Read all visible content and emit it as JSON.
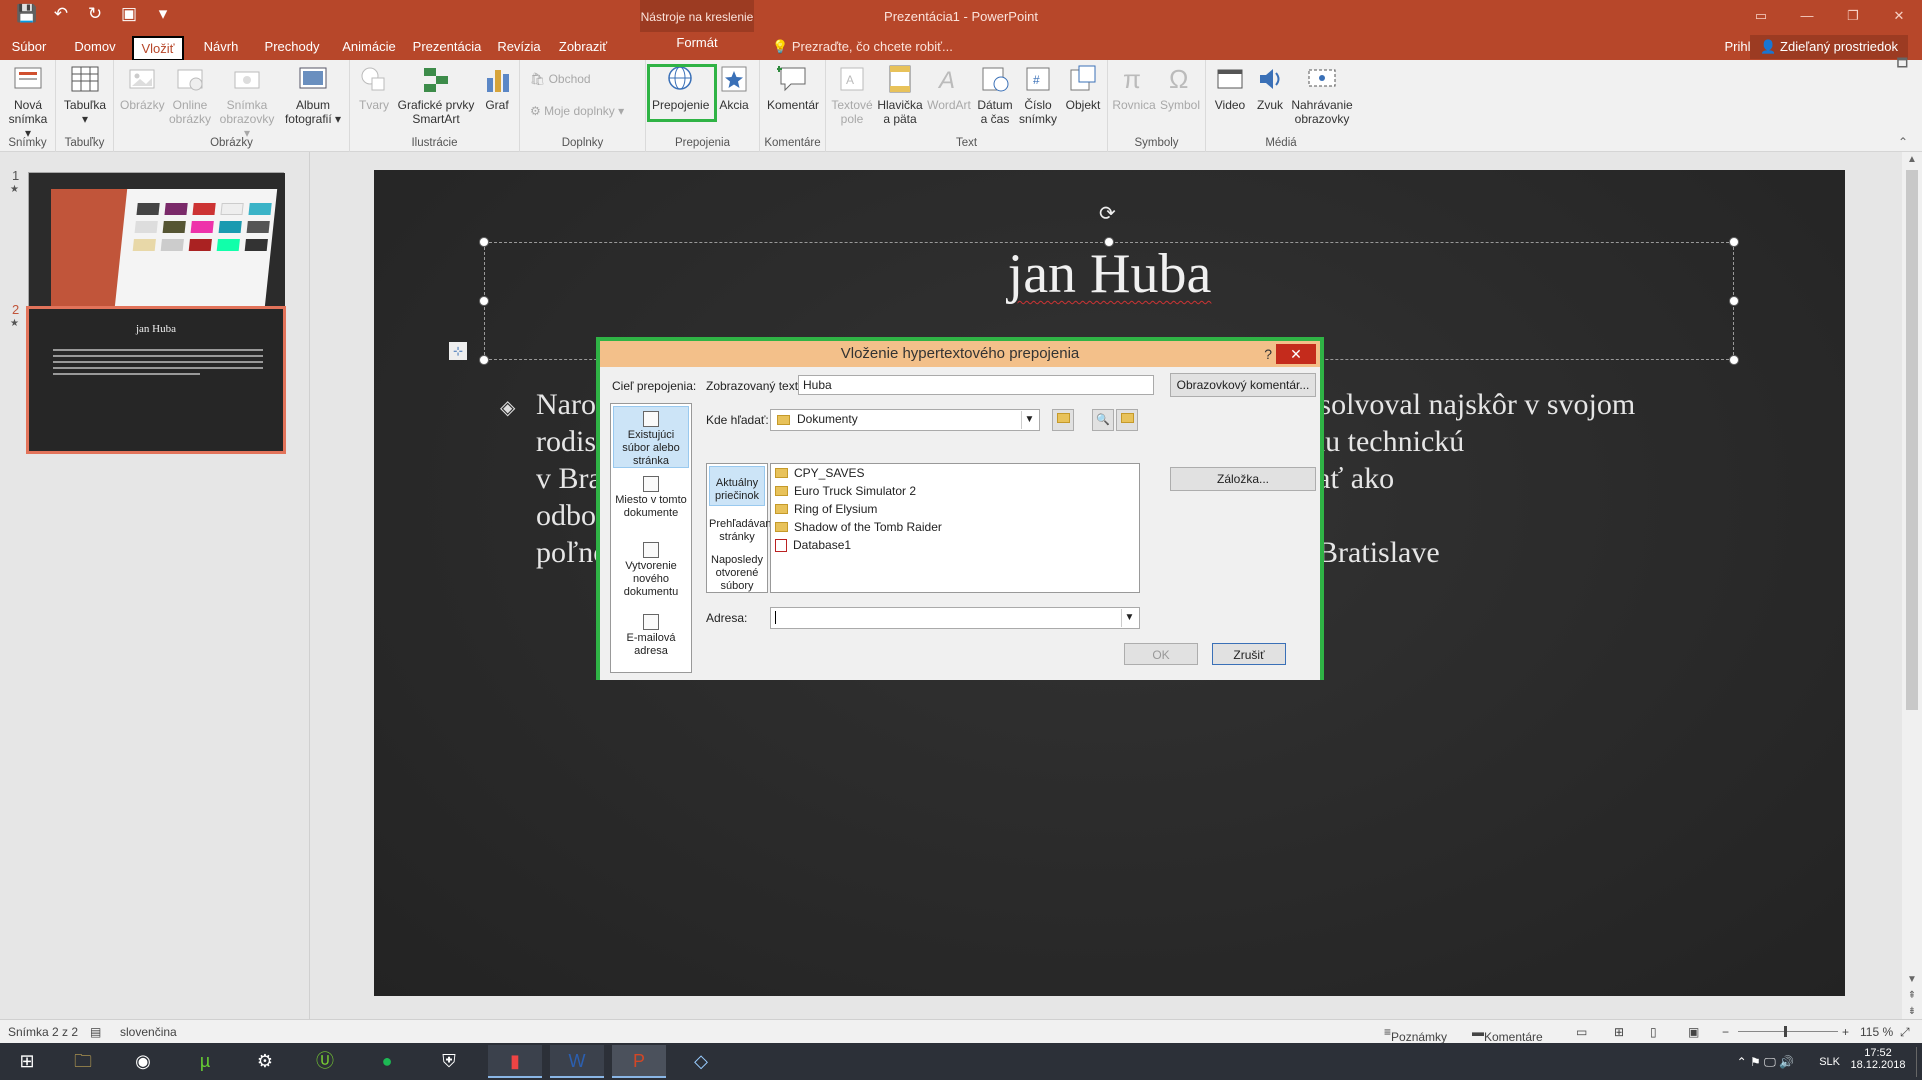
{
  "window": {
    "title": "Prezentácia1 - PowerPoint",
    "context_tab_header": "Nástroje na kreslenie",
    "controls": [
      "▭",
      "—",
      "❐",
      "✕"
    ]
  },
  "qat": [
    "💾",
    "↶",
    "↻",
    "▣",
    "▾"
  ],
  "tabs": {
    "items": [
      "Súbor",
      "Domov",
      "Vložiť",
      "Návrh",
      "Prechody",
      "Animácie",
      "Prezentácia",
      "Revízia",
      "Zobraziť"
    ],
    "format": "Formát",
    "tell_me": "Prezraďte, čo chcete robiť...",
    "sign_in": "Prihlásiť",
    "share": "Zdieľaný prostriedok"
  },
  "ribbon": {
    "groups": {
      "slides": "Snímky",
      "tables": "Tabuľky",
      "images": "Obrázky",
      "illustrations": "Ilustrácie",
      "addins": "Doplnky",
      "links": "Prepojenia",
      "comments": "Komentáre",
      "text": "Text",
      "symbols": "Symboly",
      "media": "Médiá"
    },
    "buttons": {
      "new_slide": "Nová snímka ▾",
      "table": "Tabuľka ▾",
      "pictures": "Obrázky",
      "online_pictures": "Online obrázky",
      "screenshot": "Snímka obrazovky ▾",
      "photo_album": "Album fotografií ▾",
      "shapes": "Tvary",
      "smartart": "Grafické prvky SmartArt",
      "chart": "Graf",
      "store": "Obchod",
      "my_addins": "Moje doplnky",
      "hyperlink": "Prepojenie",
      "action": "Akcia",
      "comment": "Komentár",
      "text_box": "Textové pole",
      "header_footer": "Hlavička a päta",
      "wordart": "WordArt",
      "date_time": "Dátum a čas",
      "slide_number": "Číslo snímky",
      "object": "Objekt",
      "equation": "Rovnica",
      "symbol": "Symbol",
      "video": "Video",
      "audio": "Zvuk",
      "screen_recording": "Nahrávanie obrazovky"
    }
  },
  "thumbnails": [
    {
      "number": "1",
      "star": "★"
    },
    {
      "number": "2",
      "star": "★",
      "title": "jan Huba"
    }
  ],
  "slide": {
    "title": "jan Huba",
    "body_lines": [
      "Narodil sa v Spišskej Novej Vsi. Základné a stredné vzdelanie absolvoval najskôr v svojom",
      "rodisku, potom v Košiciach. V roku 1964 absolvoval Vysokú školu technickú",
      "v Bratislave. Jako školený poľnohospodár po štúdiu začal pracovať ako",
      "odborný pracovník na poľnohospodárskych ústavov",
      "poľnohospodársky v Bratislave. Zomrel 14. apríla v roku 2008 v Bratislave"
    ]
  },
  "dialog": {
    "title": "Vloženie hypertextového prepojenia",
    "help": "?",
    "close": "✕",
    "link_to_label": "Cieľ prepojenia:",
    "display_text_label": "Zobrazovaný text:",
    "display_text_value": "Huba",
    "screentip_button": "Obrazovkový komentár...",
    "look_in_label": "Kde hľadať:",
    "look_in_value": "Dokumenty",
    "bookmark_button": "Záložka...",
    "address_label": "Adresa:",
    "address_value": "",
    "ok": "OK",
    "cancel": "Zrušiť",
    "link_targets": [
      "Existujúci súbor alebo stránka",
      "Miesto v tomto dokumente",
      "Vytvorenie nového dokumentu",
      "E-mailová adresa"
    ],
    "look_in_options": [
      "Aktuálny priečinok",
      "Prehľadávané stránky",
      "Naposledy otvorené súbory"
    ],
    "files": [
      {
        "name": "CPY_SAVES",
        "type": "folder"
      },
      {
        "name": "Euro Truck Simulator 2",
        "type": "folder"
      },
      {
        "name": "Ring of Elysium",
        "type": "folder"
      },
      {
        "name": "Shadow of the Tomb Raider",
        "type": "folder"
      },
      {
        "name": "Database1",
        "type": "access"
      }
    ]
  },
  "status": {
    "slide_info": "Snímka 2 z 2",
    "language": "slovenčina",
    "notes": "Poznámky",
    "comments": "Komentáre",
    "zoom": "115 %"
  },
  "taskbar": {
    "clock_time": "17:52",
    "clock_date": "18.12.2018",
    "lang": "SLK"
  },
  "colors": {
    "accent": "#b7472a",
    "highlight": "#2fb345",
    "dialog_title": "#f3c08a"
  }
}
